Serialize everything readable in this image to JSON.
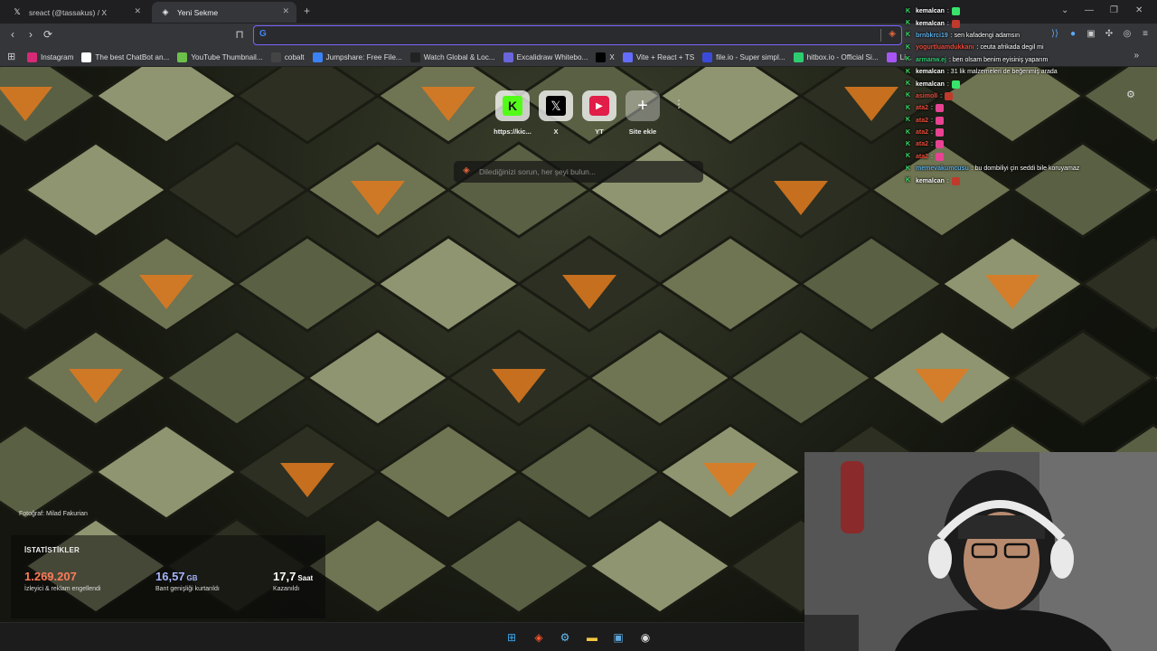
{
  "tabs": [
    {
      "label": "sreact (@tassakus) / X",
      "icon": "x-logo-icon"
    },
    {
      "label": "Yeni Sekme",
      "icon": "brave-shield-icon"
    }
  ],
  "omnibox": {
    "value": "",
    "placeholder": ""
  },
  "bookmarks": [
    {
      "label": "Instagram",
      "color": "#d62976"
    },
    {
      "label": "The best ChatBot an...",
      "color": "#ffffff"
    },
    {
      "label": "YouTube Thumbnail...",
      "color": "#6cc04a"
    },
    {
      "label": "cobalt",
      "color": "#444444"
    },
    {
      "label": "Jumpshare: Free File...",
      "color": "#3b82f6"
    },
    {
      "label": "Watch Global & Loc...",
      "color": "#222222"
    },
    {
      "label": "Excalidraw Whitebo...",
      "color": "#6965db"
    },
    {
      "label": "X",
      "color": "#000000"
    },
    {
      "label": "Vite + React + TS",
      "color": "#646cff"
    },
    {
      "label": "file.io - Super simpl...",
      "color": "#3b4bd8"
    },
    {
      "label": "hitbox.io - Official Si...",
      "color": "#2ecc71"
    },
    {
      "label": "Li...",
      "color": "#a855f7"
    }
  ],
  "top_sites": [
    {
      "label": "https://kic...",
      "color": "#53fc18"
    },
    {
      "label": "X",
      "color": "#000000"
    },
    {
      "label": "YT",
      "color": "#e11d48"
    },
    {
      "label": "Site ekle",
      "color": "#ffffff"
    }
  ],
  "ntp_search": {
    "placeholder": "Dilediğinizi sorun, her şeyi bulun..."
  },
  "photo_credit": "Fotoğraf: Milad Fakurian",
  "stats": {
    "title": "İSTATİSTİKLER",
    "blocked": {
      "value": "1.269.207",
      "desc": "İzleyici & reklam engellendi",
      "color": "#ff7a59"
    },
    "bandwidth": {
      "value": "16,57",
      "unit": "GB",
      "desc": "Bant genişliği kurtarıldı",
      "color": "#a5b4fc"
    },
    "time": {
      "value": "17,7",
      "unit": "Saat",
      "desc": "Kazanıldı",
      "color": "#ffffff"
    }
  },
  "chat": [
    {
      "user": "kemalcan",
      "text": ":",
      "user_color": "#ffffff",
      "emote": "#39e36b"
    },
    {
      "user": "kemalcan",
      "text": ":",
      "user_color": "#ffffff",
      "emote": "#c0392b"
    },
    {
      "user": "brnbkrci19",
      "text": ": sen kafadengi adamsın",
      "user_color": "#5dade2",
      "emote": ""
    },
    {
      "user": "yogurtluamdukkanı",
      "text": ": ceuta afrikada degil mi",
      "user_color": "#e74c3c",
      "emote": ""
    },
    {
      "user": "armanw.ej",
      "text": ": ben olsam benim eyisiniş yaparım",
      "user_color": "#2ecc71",
      "emote": ""
    },
    {
      "user": "kemalcan",
      "text": ": 31 lik malzemeleri de beğenmiş arada",
      "user_color": "#ffffff",
      "emote": ""
    },
    {
      "user": "kemalcan",
      "text": ":",
      "user_color": "#ffffff",
      "emote": "#39e36b"
    },
    {
      "user": "asimoll",
      "text": ":",
      "user_color": "#e74c3c",
      "emote": "#c0392b"
    },
    {
      "user": "ata2",
      "text": ":",
      "user_color": "#e74c3c",
      "emote": "#e84393"
    },
    {
      "user": "ata2",
      "text": ":",
      "user_color": "#e74c3c",
      "emote": "#e84393"
    },
    {
      "user": "ata2",
      "text": ":",
      "user_color": "#e74c3c",
      "emote": "#e84393"
    },
    {
      "user": "ata2",
      "text": ":",
      "user_color": "#e74c3c",
      "emote": "#e84393"
    },
    {
      "user": "ata2",
      "text": ":",
      "user_color": "#e74c3c",
      "emote": "#e84393"
    },
    {
      "user": "memevakumcusu",
      "text": ": bu dombiliyi çin seddi bile koruyamaz",
      "user_color": "#5dade2",
      "emote": ""
    },
    {
      "user": "kemalcan",
      "text": ":",
      "user_color": "#ffffff",
      "emote": "#c0392b"
    }
  ],
  "taskbar": [
    {
      "name": "windows-start-icon",
      "color": "#3ba7f0"
    },
    {
      "name": "brave-browser-icon",
      "color": "#fb542b"
    },
    {
      "name": "steam-icon",
      "color": "#66c0f4"
    },
    {
      "name": "file-explorer-icon",
      "color": "#f4c542"
    },
    {
      "name": "photos-icon",
      "color": "#5fa8e0"
    },
    {
      "name": "obs-icon",
      "color": "#dddddd"
    }
  ]
}
